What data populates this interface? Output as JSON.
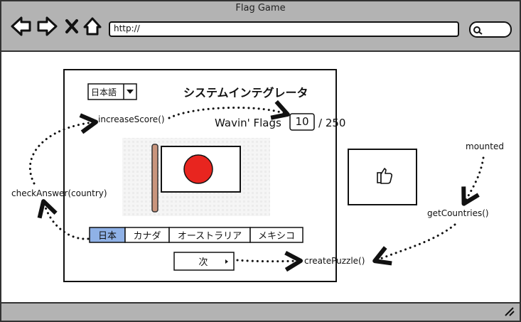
{
  "window": {
    "title": "Flag Game",
    "url": "http://"
  },
  "toolbar": {
    "back_icon": "arrow-left-icon",
    "forward_icon": "arrow-right-icon",
    "stop_icon": "close-icon",
    "home_icon": "home-icon",
    "search_icon": "search-icon"
  },
  "app": {
    "language": "日本語",
    "heading": "システムインテグレータ",
    "game_title": "Wavin' Flags",
    "score": "10",
    "total": "/ 250",
    "feedback_icon": "thumbs-up-icon",
    "flag_icon": "japan-flag-icon",
    "options": [
      {
        "label": "日本",
        "selected": true
      },
      {
        "label": "カナダ",
        "selected": false
      },
      {
        "label": "オーストラリア",
        "selected": false
      },
      {
        "label": "メキシコ",
        "selected": false
      }
    ],
    "next_label": "次"
  },
  "flow": {
    "increase_score": "increaseScore()",
    "check_answer": "checkAnswer(country)",
    "mounted": "mounted",
    "get_countries": "getCountries()",
    "create_puzzle": "createPuzzle()"
  },
  "colors": {
    "chrome": "#b3b3b3",
    "selected_option": "#8fb1e6",
    "flag_circle": "#e8251f",
    "flag_pole": "#c9957d"
  }
}
